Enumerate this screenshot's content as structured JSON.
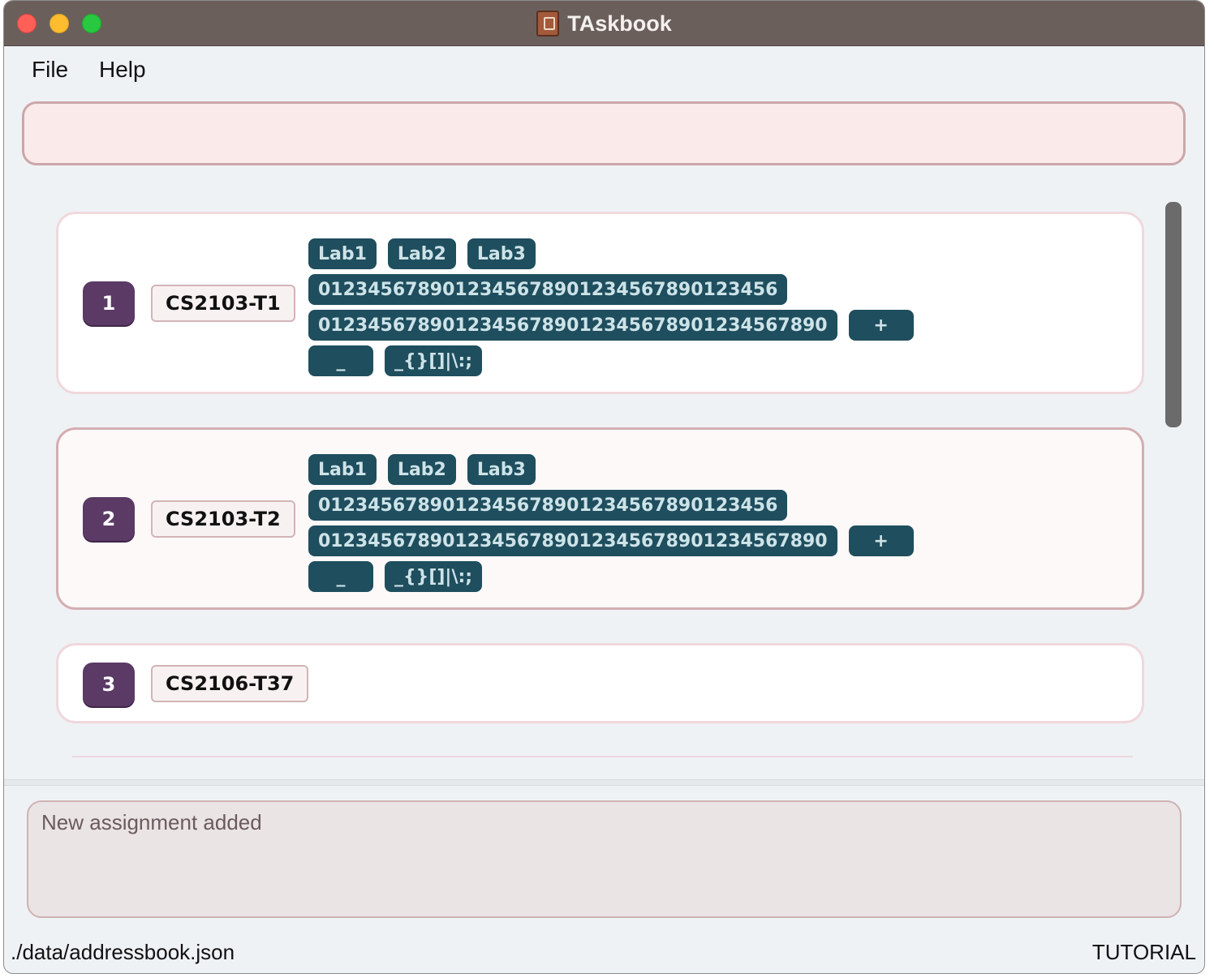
{
  "window": {
    "title": "TAskbook",
    "app_icon": "addressbook-icon"
  },
  "menu": {
    "file_label": "File",
    "help_label": "Help"
  },
  "command_box": {
    "value": ""
  },
  "list": {
    "cards": [
      {
        "index": "1",
        "name": "CS2103-T1",
        "selected": false,
        "tag_rows": [
          [
            "Lab1",
            "Lab2",
            "Lab3"
          ],
          [
            "0123456789012345678901234567890123456"
          ],
          [
            "0123456789012345678901234567890123456789​0",
            "+"
          ],
          [
            "_",
            "_{}[]|\\:;"
          ]
        ]
      },
      {
        "index": "2",
        "name": "CS2103-T2",
        "selected": true,
        "tag_rows": [
          [
            "Lab1",
            "Lab2",
            "Lab3"
          ],
          [
            "0123456789012345678901234567890123456"
          ],
          [
            "0123456789012345678901234567890123456789​0",
            "+"
          ],
          [
            "_",
            "_{}[]|\\:;"
          ]
        ]
      },
      {
        "index": "3",
        "name": "CS2106-T37",
        "selected": false,
        "tag_rows": []
      }
    ]
  },
  "result_display": {
    "text": "New assignment added"
  },
  "status_bar": {
    "file_path": "./data/addressbook.json",
    "mode": "TUTORIAL"
  },
  "colors": {
    "titlebar": "#6b5f5c",
    "tag_bg": "#1f4e5e",
    "index_badge": "#5b3a66",
    "command_box_bg": "#fbeaea"
  }
}
